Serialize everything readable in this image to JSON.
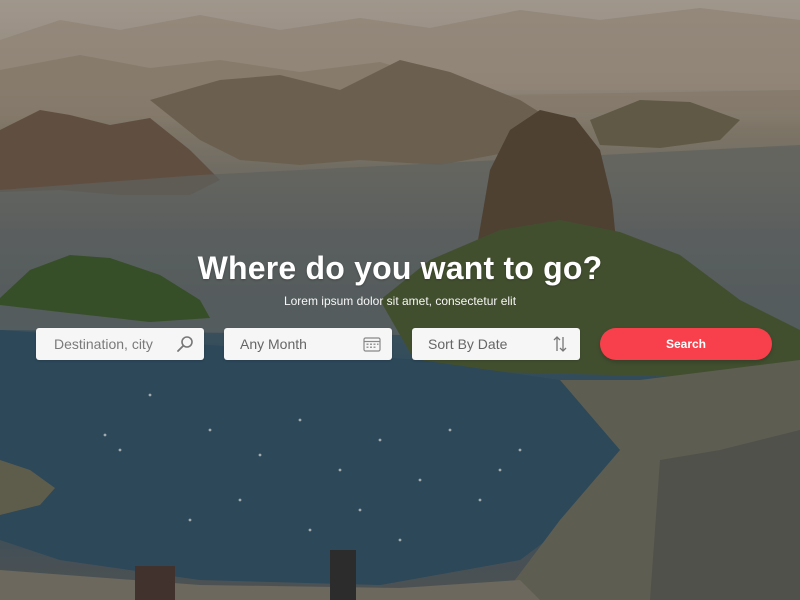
{
  "hero": {
    "title": "Where do you want to go?",
    "subtitle": "Lorem ipsum dolor sit amet, consectetur elit"
  },
  "search_form": {
    "destination": {
      "placeholder": "Destination, city",
      "icon": "search-icon"
    },
    "month": {
      "value": "Any Month",
      "icon": "calendar-icon"
    },
    "sort": {
      "value": "Sort By Date",
      "icon": "sort-arrows-icon"
    },
    "submit_label": "Search"
  },
  "colors": {
    "accent": "#f7404b",
    "field_bg": "#f6f6f6"
  }
}
